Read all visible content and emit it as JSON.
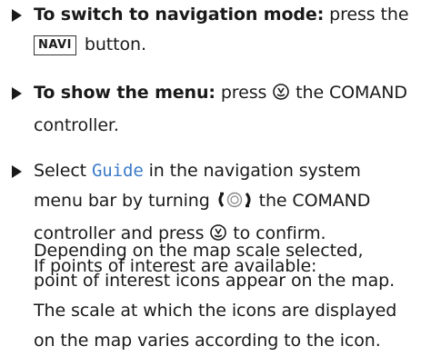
{
  "step1": {
    "label": "To switch to navigation mode:",
    "text_a": " press the",
    "key": "NAVI",
    "text_b": " button."
  },
  "step2": {
    "label": "To show the menu:",
    "text_a": " press ",
    "text_b": " the COMAND",
    "text_c": "controller."
  },
  "step3": {
    "text_a": "Select ",
    "guide": "Guide",
    "text_b": " in the navigation system",
    "text_c": "menu bar by turning ",
    "text_d": " the COMAND",
    "text_e": "controller and press ",
    "text_f": " to confirm.",
    "text_g": "If points of interest are available:"
  },
  "paragraph": {
    "lines": [
      "Depending on the map scale selected,",
      "point of interest icons appear on the map.",
      "The scale at which the icons are displayed",
      "on the map varies according to the icon."
    ]
  },
  "icons": {
    "press": "press-controller-icon",
    "turn": "turn-controller-icon"
  }
}
